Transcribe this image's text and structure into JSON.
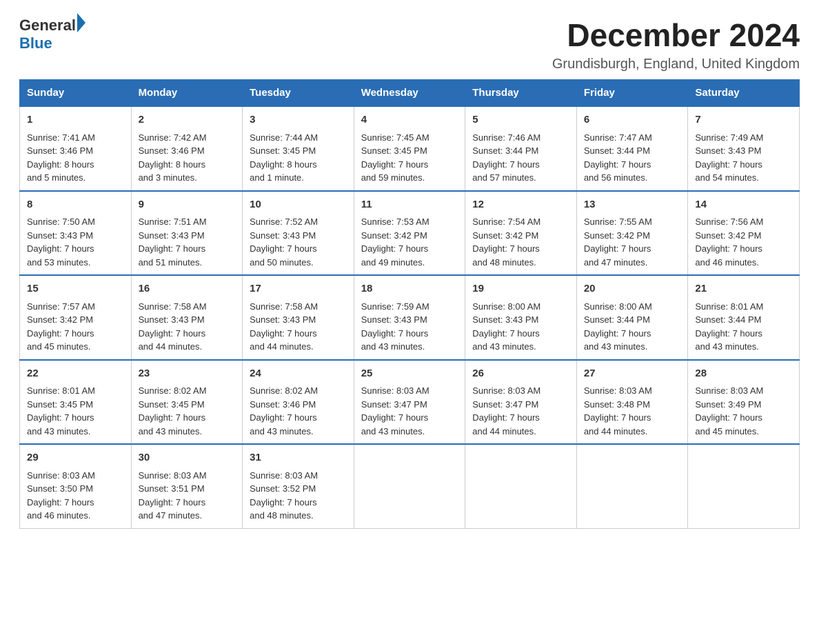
{
  "logo": {
    "general": "General",
    "blue": "Blue"
  },
  "title": "December 2024",
  "subtitle": "Grundisburgh, England, United Kingdom",
  "headers": [
    "Sunday",
    "Monday",
    "Tuesday",
    "Wednesday",
    "Thursday",
    "Friday",
    "Saturday"
  ],
  "weeks": [
    [
      {
        "day": "1",
        "sunrise": "Sunrise: 7:41 AM",
        "sunset": "Sunset: 3:46 PM",
        "daylight": "Daylight: 8 hours",
        "daylight2": "and 5 minutes."
      },
      {
        "day": "2",
        "sunrise": "Sunrise: 7:42 AM",
        "sunset": "Sunset: 3:46 PM",
        "daylight": "Daylight: 8 hours",
        "daylight2": "and 3 minutes."
      },
      {
        "day": "3",
        "sunrise": "Sunrise: 7:44 AM",
        "sunset": "Sunset: 3:45 PM",
        "daylight": "Daylight: 8 hours",
        "daylight2": "and 1 minute."
      },
      {
        "day": "4",
        "sunrise": "Sunrise: 7:45 AM",
        "sunset": "Sunset: 3:45 PM",
        "daylight": "Daylight: 7 hours",
        "daylight2": "and 59 minutes."
      },
      {
        "day": "5",
        "sunrise": "Sunrise: 7:46 AM",
        "sunset": "Sunset: 3:44 PM",
        "daylight": "Daylight: 7 hours",
        "daylight2": "and 57 minutes."
      },
      {
        "day": "6",
        "sunrise": "Sunrise: 7:47 AM",
        "sunset": "Sunset: 3:44 PM",
        "daylight": "Daylight: 7 hours",
        "daylight2": "and 56 minutes."
      },
      {
        "day": "7",
        "sunrise": "Sunrise: 7:49 AM",
        "sunset": "Sunset: 3:43 PM",
        "daylight": "Daylight: 7 hours",
        "daylight2": "and 54 minutes."
      }
    ],
    [
      {
        "day": "8",
        "sunrise": "Sunrise: 7:50 AM",
        "sunset": "Sunset: 3:43 PM",
        "daylight": "Daylight: 7 hours",
        "daylight2": "and 53 minutes."
      },
      {
        "day": "9",
        "sunrise": "Sunrise: 7:51 AM",
        "sunset": "Sunset: 3:43 PM",
        "daylight": "Daylight: 7 hours",
        "daylight2": "and 51 minutes."
      },
      {
        "day": "10",
        "sunrise": "Sunrise: 7:52 AM",
        "sunset": "Sunset: 3:43 PM",
        "daylight": "Daylight: 7 hours",
        "daylight2": "and 50 minutes."
      },
      {
        "day": "11",
        "sunrise": "Sunrise: 7:53 AM",
        "sunset": "Sunset: 3:42 PM",
        "daylight": "Daylight: 7 hours",
        "daylight2": "and 49 minutes."
      },
      {
        "day": "12",
        "sunrise": "Sunrise: 7:54 AM",
        "sunset": "Sunset: 3:42 PM",
        "daylight": "Daylight: 7 hours",
        "daylight2": "and 48 minutes."
      },
      {
        "day": "13",
        "sunrise": "Sunrise: 7:55 AM",
        "sunset": "Sunset: 3:42 PM",
        "daylight": "Daylight: 7 hours",
        "daylight2": "and 47 minutes."
      },
      {
        "day": "14",
        "sunrise": "Sunrise: 7:56 AM",
        "sunset": "Sunset: 3:42 PM",
        "daylight": "Daylight: 7 hours",
        "daylight2": "and 46 minutes."
      }
    ],
    [
      {
        "day": "15",
        "sunrise": "Sunrise: 7:57 AM",
        "sunset": "Sunset: 3:42 PM",
        "daylight": "Daylight: 7 hours",
        "daylight2": "and 45 minutes."
      },
      {
        "day": "16",
        "sunrise": "Sunrise: 7:58 AM",
        "sunset": "Sunset: 3:43 PM",
        "daylight": "Daylight: 7 hours",
        "daylight2": "and 44 minutes."
      },
      {
        "day": "17",
        "sunrise": "Sunrise: 7:58 AM",
        "sunset": "Sunset: 3:43 PM",
        "daylight": "Daylight: 7 hours",
        "daylight2": "and 44 minutes."
      },
      {
        "day": "18",
        "sunrise": "Sunrise: 7:59 AM",
        "sunset": "Sunset: 3:43 PM",
        "daylight": "Daylight: 7 hours",
        "daylight2": "and 43 minutes."
      },
      {
        "day": "19",
        "sunrise": "Sunrise: 8:00 AM",
        "sunset": "Sunset: 3:43 PM",
        "daylight": "Daylight: 7 hours",
        "daylight2": "and 43 minutes."
      },
      {
        "day": "20",
        "sunrise": "Sunrise: 8:00 AM",
        "sunset": "Sunset: 3:44 PM",
        "daylight": "Daylight: 7 hours",
        "daylight2": "and 43 minutes."
      },
      {
        "day": "21",
        "sunrise": "Sunrise: 8:01 AM",
        "sunset": "Sunset: 3:44 PM",
        "daylight": "Daylight: 7 hours",
        "daylight2": "and 43 minutes."
      }
    ],
    [
      {
        "day": "22",
        "sunrise": "Sunrise: 8:01 AM",
        "sunset": "Sunset: 3:45 PM",
        "daylight": "Daylight: 7 hours",
        "daylight2": "and 43 minutes."
      },
      {
        "day": "23",
        "sunrise": "Sunrise: 8:02 AM",
        "sunset": "Sunset: 3:45 PM",
        "daylight": "Daylight: 7 hours",
        "daylight2": "and 43 minutes."
      },
      {
        "day": "24",
        "sunrise": "Sunrise: 8:02 AM",
        "sunset": "Sunset: 3:46 PM",
        "daylight": "Daylight: 7 hours",
        "daylight2": "and 43 minutes."
      },
      {
        "day": "25",
        "sunrise": "Sunrise: 8:03 AM",
        "sunset": "Sunset: 3:47 PM",
        "daylight": "Daylight: 7 hours",
        "daylight2": "and 43 minutes."
      },
      {
        "day": "26",
        "sunrise": "Sunrise: 8:03 AM",
        "sunset": "Sunset: 3:47 PM",
        "daylight": "Daylight: 7 hours",
        "daylight2": "and 44 minutes."
      },
      {
        "day": "27",
        "sunrise": "Sunrise: 8:03 AM",
        "sunset": "Sunset: 3:48 PM",
        "daylight": "Daylight: 7 hours",
        "daylight2": "and 44 minutes."
      },
      {
        "day": "28",
        "sunrise": "Sunrise: 8:03 AM",
        "sunset": "Sunset: 3:49 PM",
        "daylight": "Daylight: 7 hours",
        "daylight2": "and 45 minutes."
      }
    ],
    [
      {
        "day": "29",
        "sunrise": "Sunrise: 8:03 AM",
        "sunset": "Sunset: 3:50 PM",
        "daylight": "Daylight: 7 hours",
        "daylight2": "and 46 minutes."
      },
      {
        "day": "30",
        "sunrise": "Sunrise: 8:03 AM",
        "sunset": "Sunset: 3:51 PM",
        "daylight": "Daylight: 7 hours",
        "daylight2": "and 47 minutes."
      },
      {
        "day": "31",
        "sunrise": "Sunrise: 8:03 AM",
        "sunset": "Sunset: 3:52 PM",
        "daylight": "Daylight: 7 hours",
        "daylight2": "and 48 minutes."
      },
      null,
      null,
      null,
      null
    ]
  ]
}
